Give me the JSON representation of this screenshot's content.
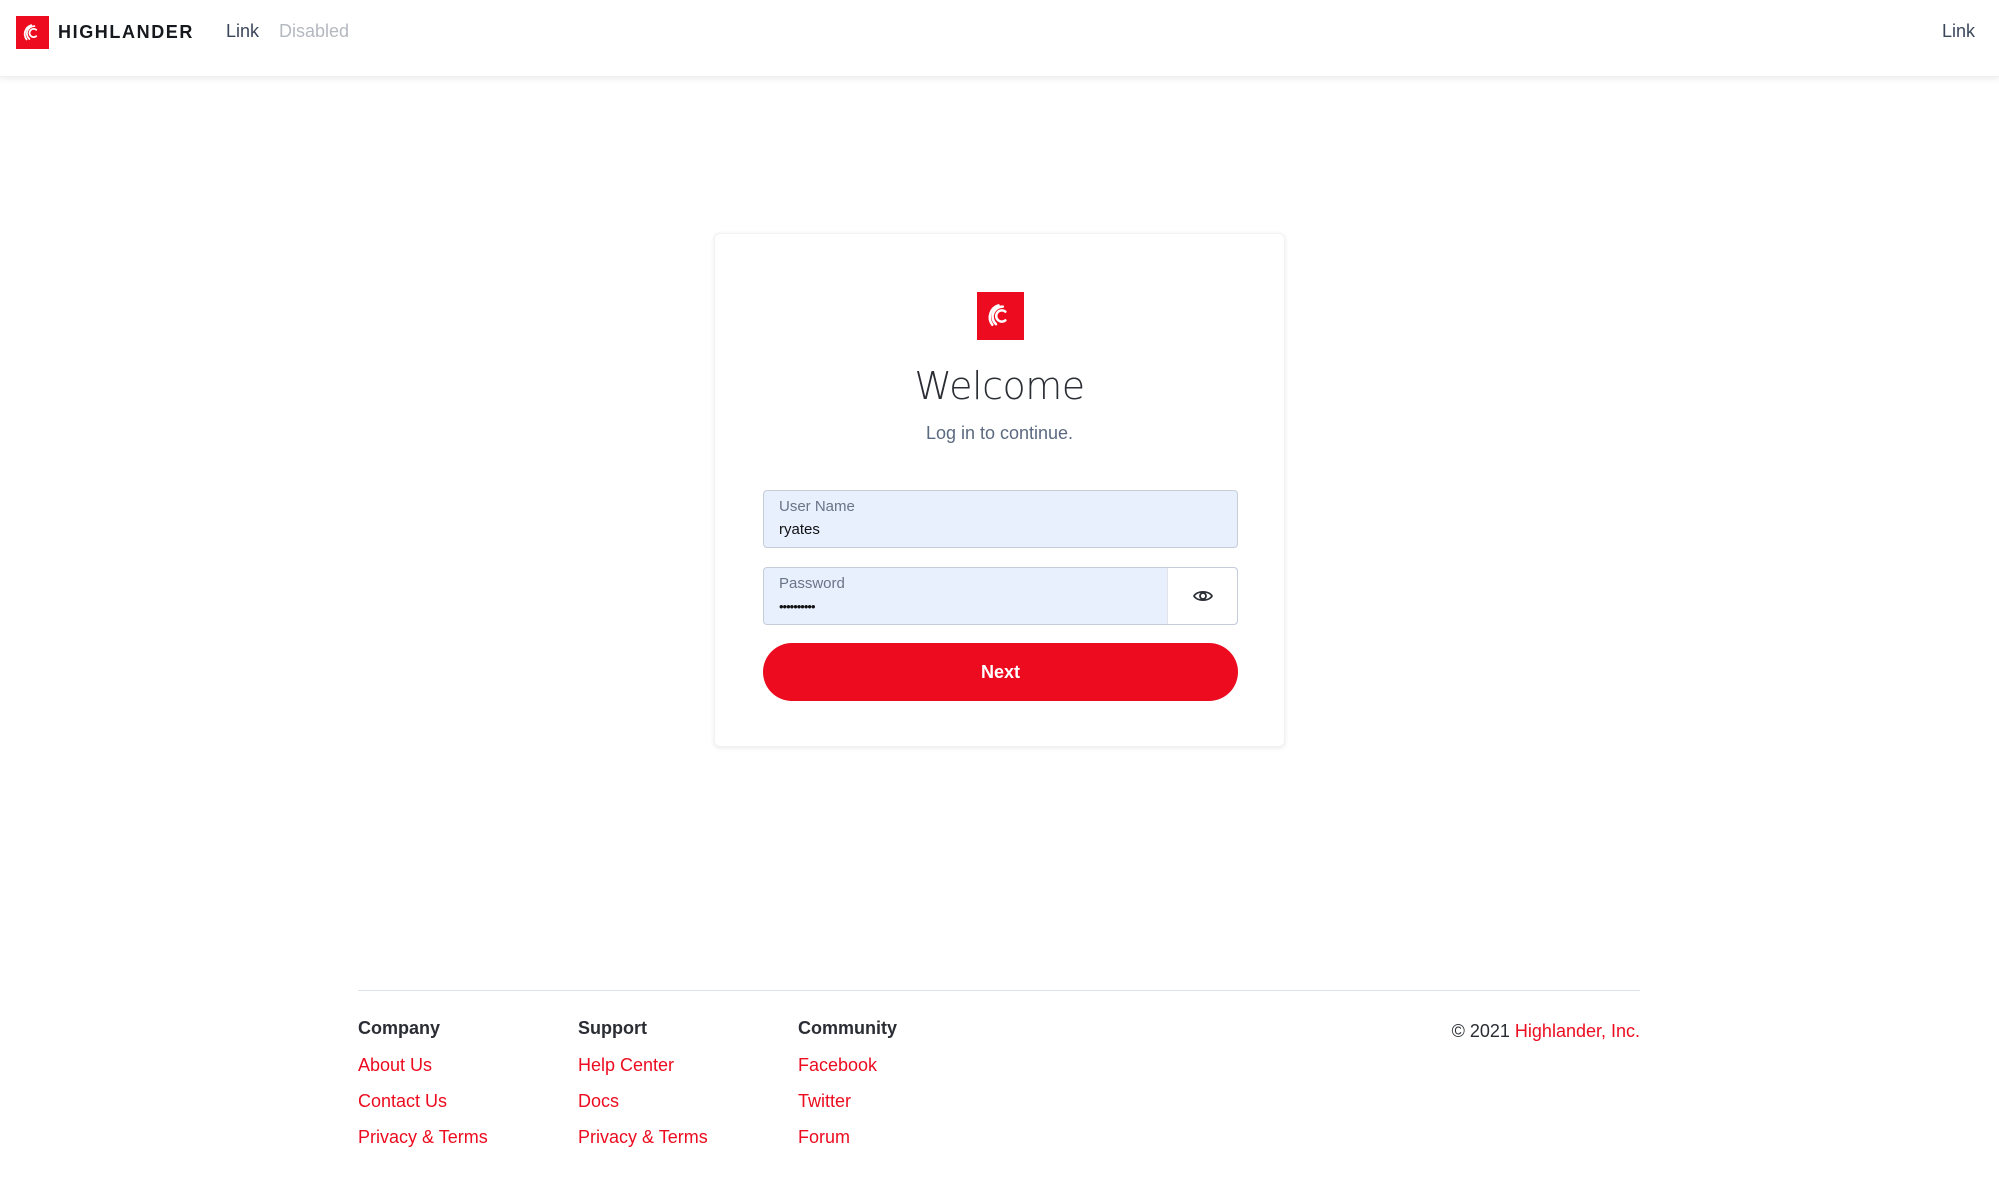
{
  "header": {
    "brand_name": "HIGHLANDER",
    "nav": [
      {
        "label": "Link",
        "state": "enabled"
      },
      {
        "label": "Disabled",
        "state": "disabled"
      }
    ],
    "right_link": "Link"
  },
  "login": {
    "title": "Welcome",
    "subtitle": "Log in to continue.",
    "username": {
      "label": "User Name",
      "value": "ryates"
    },
    "password": {
      "label": "Password",
      "value": "••••••••••",
      "toggle_icon": "eye-icon"
    },
    "submit_label": "Next"
  },
  "footer": {
    "columns": [
      {
        "heading": "Company",
        "links": [
          "About Us",
          "Contact Us",
          "Privacy & Terms"
        ]
      },
      {
        "heading": "Support",
        "links": [
          "Help Center",
          "Docs",
          "Privacy & Terms"
        ]
      },
      {
        "heading": "Community",
        "links": [
          "Facebook",
          "Twitter",
          "Forum"
        ]
      }
    ],
    "copyright_prefix": "© 2021",
    "copyright_company": "Highlander, Inc."
  },
  "colors": {
    "brand": "#ec0b1f",
    "input_bg": "#e8f0fe",
    "text": "#2a2d33",
    "muted": "#5b6a80"
  }
}
